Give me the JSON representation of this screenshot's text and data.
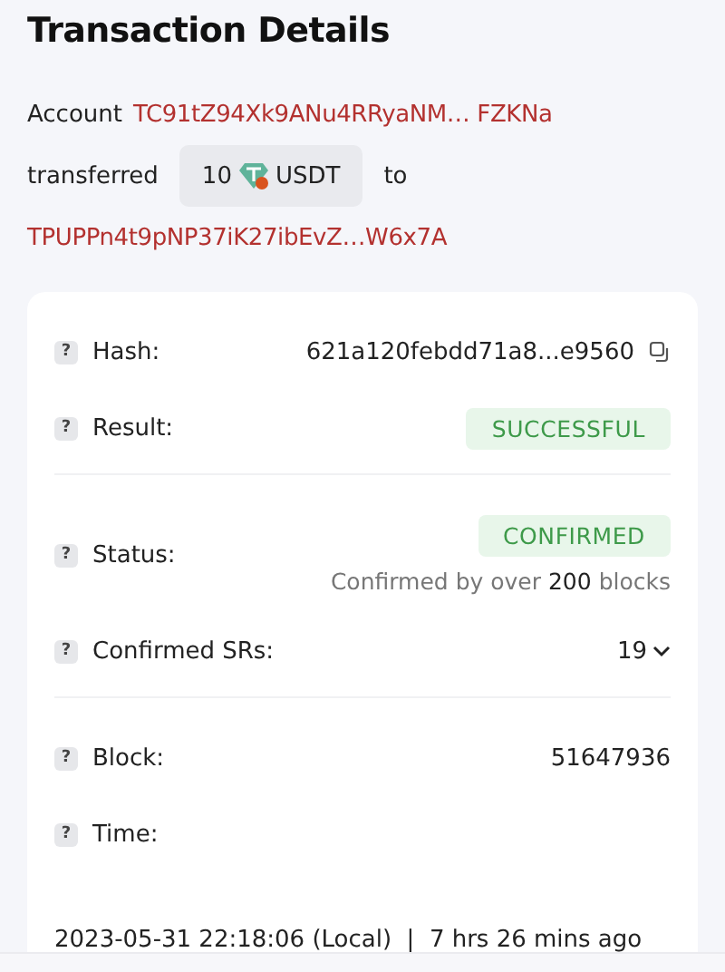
{
  "title": "Transaction Details",
  "summary": {
    "account_label": "Account",
    "from_address": "TC91tZ94Xk9ANu4RRyaNM… FZKNa",
    "transferred_label": "transferred",
    "amount": "10",
    "token": "USDT",
    "to_label": "to",
    "to_address": "TPUPPn4t9pNP37iK27ibEvZ…W6x7A"
  },
  "card": {
    "groups": [
      [
        {
          "kind": "hash",
          "help": "?",
          "label": "Hash:",
          "value": "621a120febdd71a8...e9560"
        },
        {
          "kind": "badge",
          "help": "?",
          "label": "Result:",
          "value": "SUCCESSFUL"
        }
      ],
      [
        {
          "kind": "status",
          "help": "?",
          "label": "Status:",
          "value": "CONFIRMED",
          "note": "Confirmed by over **200** blocks"
        },
        {
          "kind": "dropdown",
          "help": "?",
          "label": "Confirmed SRs:",
          "value": "19"
        }
      ],
      [
        {
          "kind": "text",
          "help": "?",
          "label": "Block:",
          "value": "51647936"
        },
        {
          "kind": "time",
          "help": "?",
          "label": "Time:",
          "value": "2023-05-31 22:18:06 (Local)  |  7 hrs 26 mins ago"
        }
      ]
    ]
  }
}
